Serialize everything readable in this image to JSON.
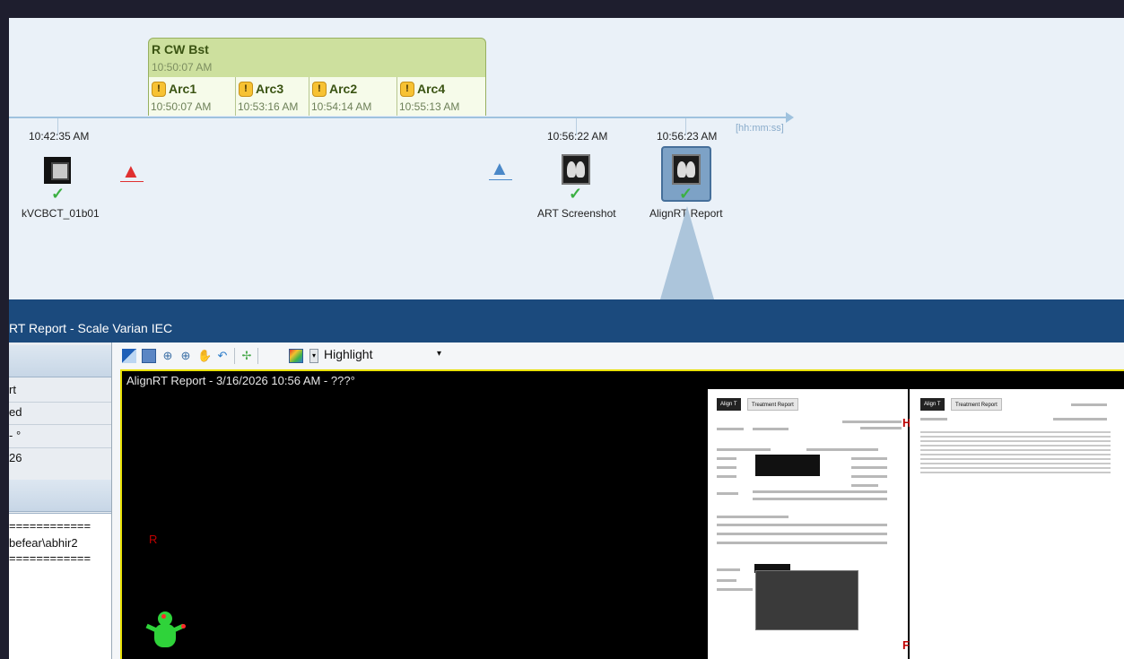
{
  "timeline": {
    "session": {
      "title": "R CW Bst",
      "time": "10:50:07 AM"
    },
    "arcs": [
      {
        "name": "Arc1",
        "time": "10:50:07 AM"
      },
      {
        "name": "Arc3",
        "time": "10:53:16 AM"
      },
      {
        "name": "Arc2",
        "time": "10:54:14 AM"
      },
      {
        "name": "Arc4",
        "time": "10:55:13 AM"
      }
    ],
    "axis_unit": "[hh:mm:ss]",
    "warning_glyph": "!",
    "check_glyph": "✓",
    "triangle_glyph": "▲",
    "events": [
      {
        "time": "10:42:35 AM",
        "label": "kVCBCT_01b01",
        "icon": "cube-image-icon",
        "checked": true
      },
      {
        "time": "",
        "label": "",
        "icon": "red-triangle-marker-icon",
        "checked": false
      },
      {
        "time": "",
        "label": "",
        "icon": "blue-triangle-marker-icon",
        "checked": false
      },
      {
        "time": "10:56:22 AM",
        "label": "ART Screenshot",
        "icon": "xray-image-icon",
        "checked": true
      },
      {
        "time": "10:56:23 AM",
        "label": "AlignRT Report",
        "icon": "xray-image-icon",
        "checked": true,
        "selected": true
      }
    ],
    "colors": {
      "session_fill": "#cde09e",
      "arc_fill": "#f6fbea",
      "warning": "#f7c233",
      "check": "#3cb043",
      "red_marker": "#e03030",
      "blue_marker": "#4a88c8"
    }
  },
  "window": {
    "title": "RT Report - Scale Varian IEC",
    "bar_color": "#1b4a7d"
  },
  "left_panel": {
    "rows": [
      "rt",
      "ed",
      " -  °",
      "26"
    ],
    "log_lines": [
      "============",
      "befear\\abhir2",
      "============"
    ]
  },
  "toolbar": {
    "icons": [
      "window-level-icon",
      "auto-window-icon",
      "zoom-in-icon",
      "zoom-fit-icon",
      "pan-hand-icon",
      "rotate-icon",
      "crosshair-icon",
      "color-map-icon"
    ],
    "dropdown_caret": "▾",
    "highlight_value": "Highlight"
  },
  "viewer": {
    "caption": "AlignRT Report - 3/16/2026 10:56 AM - ???°",
    "orientation": {
      "left": "R",
      "head": "H",
      "foot": "F"
    },
    "border_color": "#e8e000",
    "report_tabs": [
      "Align T",
      "Treatment Report"
    ]
  }
}
